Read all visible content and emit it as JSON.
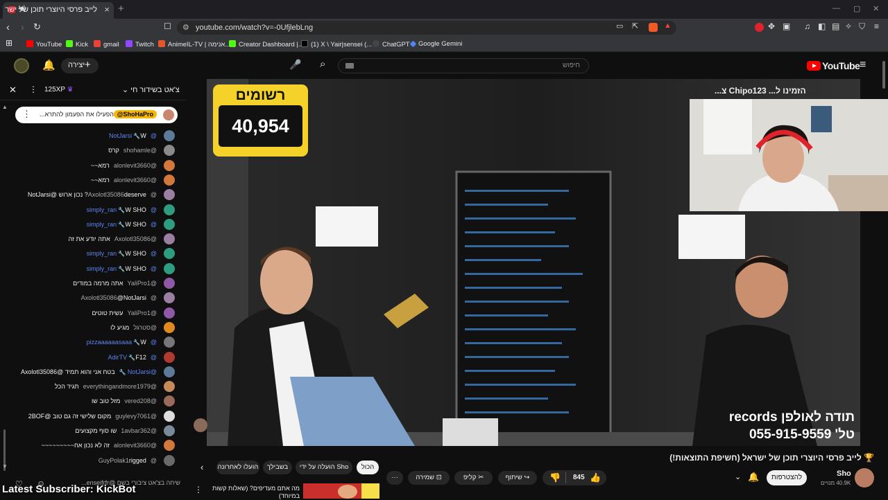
{
  "browser": {
    "tab_title": "לייב פרסי היוצרי תוכן של ישר",
    "url": "youtube.com/watch?v=-0UfjlebLng",
    "bookmarks": [
      {
        "label": "YouTube",
        "color": "#ff0000"
      },
      {
        "label": "Kick",
        "color": "#53fc18"
      },
      {
        "label": "gmail",
        "color": "#ea4335"
      },
      {
        "label": "Twitch",
        "color": "#9146ff"
      },
      {
        "label": "AnimeIL-TV | אנימה...",
        "color": "#e4572e"
      },
      {
        "label": "Creator Dashboard |...",
        "color": "#53fc18"
      },
      {
        "label": "(1) X \\ Yair|sensei (...",
        "color": "#000000"
      },
      {
        "label": "ChatGPT",
        "color": "#444444"
      },
      {
        "label": "Google Gemini",
        "color": "#4e86f5"
      }
    ]
  },
  "header": {
    "search_placeholder": "חיפוש",
    "create_label": "יצירה",
    "logo_text": "YouTube"
  },
  "chat": {
    "title": "צ'אט בשידור חי",
    "points_badge": "125XP",
    "pinned": {
      "author": "@ShoHaPro",
      "text": "הפעילו את הפעמון להתרא..."
    },
    "messages": [
      {
        "author": "@NotJarsi",
        "text": "W",
        "mod": true,
        "color": "#5d7b99"
      },
      {
        "author": "@shohamle",
        "text": "קרס",
        "mod": false,
        "color": "#8a8a8a"
      },
      {
        "author": "@alonlevit3660",
        "text": "רמא~~",
        "mod": false,
        "color": "#d2783c"
      },
      {
        "author": "@alonlevit3660",
        "text": "רמא~~",
        "mod": false,
        "color": "#d2783c"
      },
      {
        "author": "@Axolotl35086",
        "text": "deserve? נכון ארוש @NotJarsi",
        "mod": false,
        "color": "#9b7fa3"
      },
      {
        "author": "@simply_ran",
        "text": "W SHO",
        "mod": true,
        "color": "#2e9c7e"
      },
      {
        "author": "@simply_ran",
        "text": "W SHO",
        "mod": true,
        "color": "#2e9c7e"
      },
      {
        "author": "@Axolotl35086",
        "text": "אתה יודע את זה",
        "mod": false,
        "color": "#9b7fa3"
      },
      {
        "author": "@simply_ran",
        "text": "W SHO",
        "mod": true,
        "color": "#2e9c7e"
      },
      {
        "author": "@simply_ran",
        "text": "W SHO",
        "mod": true,
        "color": "#2e9c7e"
      },
      {
        "author": "@YaliPro1",
        "text": "אתה מרמה במודים",
        "mod": false,
        "color": "#8e5aa8"
      },
      {
        "author": "@Axolotl35086",
        "text": "@NotJarsi",
        "mod": false,
        "color": "#9b7fa3"
      },
      {
        "author": "@YaliPro1",
        "text": "עשית טוטים",
        "mod": false,
        "color": "#8e5aa8"
      },
      {
        "author": "@סטרגל",
        "text": "מגיע לו",
        "mod": false,
        "color": "#e08a1e"
      },
      {
        "author": "@pizzaaaaaasaaa",
        "text": "W",
        "mod": true,
        "color": "#777777"
      },
      {
        "author": "@AdirTV",
        "text": "F12",
        "mod": true,
        "color": "#b03a2e"
      },
      {
        "author": "@NotJarsi",
        "text": "בטח אני והוא תמיד @Axolotl35086",
        "mod": true,
        "color": "#5d7b99"
      },
      {
        "author": "@everythingandmore1979",
        "text": "תגיד הכל",
        "mod": false,
        "color": "#c48a58"
      },
      {
        "author": "@vered208",
        "text": "מזל טוב שו",
        "mod": false,
        "color": "#9a6a5a"
      },
      {
        "author": "@guylevy7061",
        "text": "מקום שלישי זה גם טוב @2BOF",
        "mod": false,
        "color": "#dddddd"
      },
      {
        "author": "@1avbar362",
        "text": "שו סוף מקצועים",
        "mod": false,
        "color": "#7a8a9a"
      },
      {
        "author": "@alonlevit3660",
        "text": "זה לא נכון אח~~~~~~~~~",
        "mod": false,
        "color": "#d2783c"
      },
      {
        "author": "@GuyPolak1",
        "text": "rigged",
        "mod": false,
        "color": "#6a6a6a"
      }
    ],
    "input_placeholder": "שיחה בצ'אט ציבורי בשם @enseifrfr..."
  },
  "video": {
    "subs_title": "רשומים",
    "subs_count": "40,954",
    "webcam_overlay": "הזמינו ל... Chipo123 צ...",
    "sponsor_line1": "תודה לאולפן records",
    "sponsor_line2": "טל' 055-915-9559",
    "latest_subscriber": "Latest Subscriber: KickBot"
  },
  "below": {
    "title": "🏆 לייב פרסי היוצרי תוכן של ישראל (חשיפת התוצאות!)",
    "channel_name": "Sho",
    "subscriber_count": "40.9K מנויים",
    "subscribe_label": "להצטרפות",
    "likes": "845",
    "share_label": "שיתוף",
    "clip_label": "קליפ",
    "save_label": "שמירה",
    "chips": [
      "הכול",
      "הועלה על ידי Sho",
      "בשבילך",
      "הועלו לאחרונה"
    ],
    "related_title": "מה אתם מעדיפים? (שאלות קשות במיוחד)"
  }
}
